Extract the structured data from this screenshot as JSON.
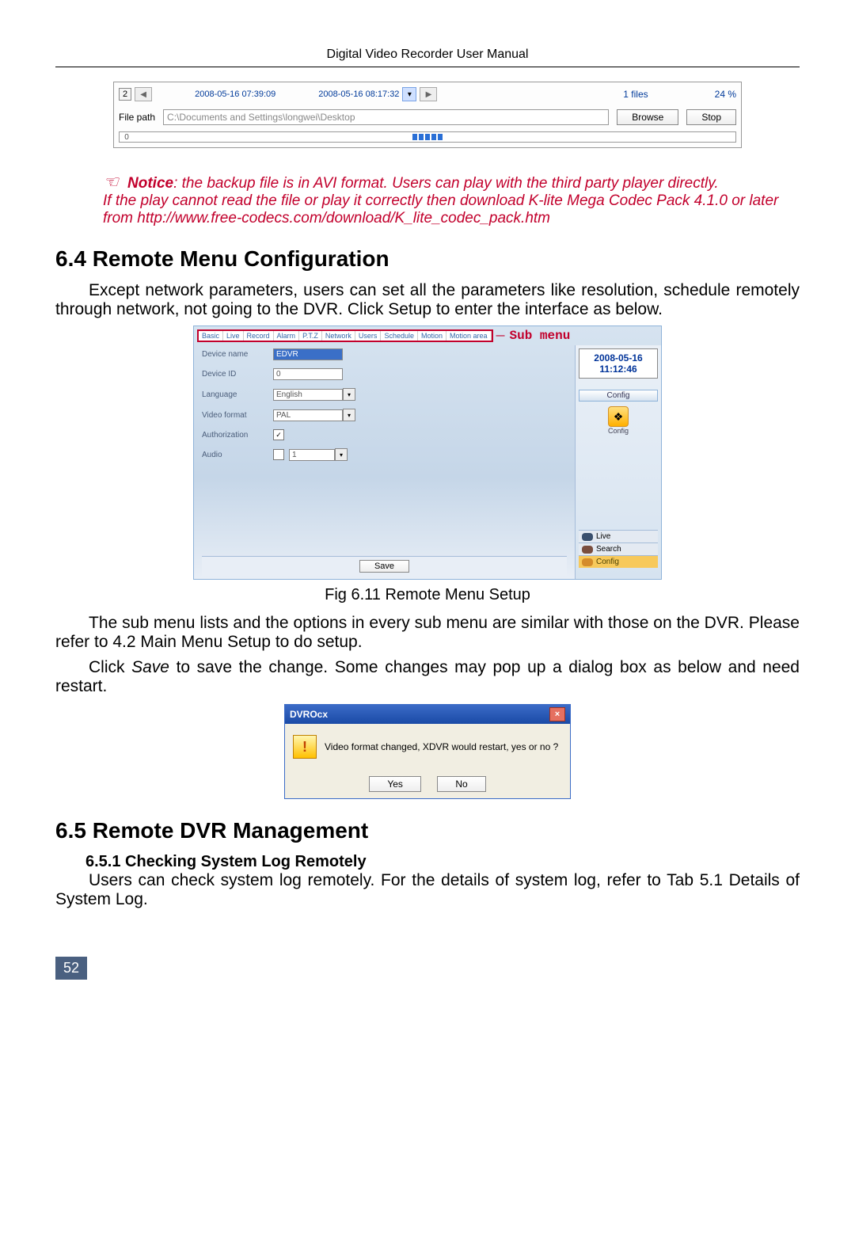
{
  "header": "Digital Video Recorder User Manual",
  "backup": {
    "num": "2",
    "time1": "2008-05-16 07:39:09",
    "time2": "2008-05-16 08:17:32",
    "files": "1 files",
    "pct": "24 %",
    "file_path_label": "File path",
    "file_path_value": "C:\\Documents and Settings\\longwei\\Desktop",
    "browse": "Browse",
    "stop": "Stop",
    "zero": "0"
  },
  "notice": {
    "label": "Notice",
    "line1": ": the backup file is in AVI format. Users can play with the third party player directly.",
    "line2": "If the play cannot read the file or play it correctly then download K-lite Mega Codec Pack 4.1.0 or later from http://www.free-codecs.com/download/K_lite_codec_pack.htm"
  },
  "s64": {
    "title": "6.4  Remote Menu Configuration",
    "para": "Except network parameters, users can set all the parameters like resolution, schedule remotely through network, not going to the DVR. Click Setup to enter the interface as below."
  },
  "remote": {
    "tabs": [
      "Basic",
      "Live",
      "Record",
      "Alarm",
      "P.T.Z",
      "Network",
      "Users",
      "Schedule",
      "Motion",
      "Motion area"
    ],
    "sub_menu": "Sub menu",
    "rows": {
      "device_name_label": "Device name",
      "device_name_value": "EDVR",
      "device_id_label": "Device ID",
      "device_id_value": "0",
      "language_label": "Language",
      "language_value": "English",
      "video_format_label": "Video format",
      "video_format_value": "PAL",
      "authorization_label": "Authorization",
      "audio_label": "Audio",
      "audio_value": "1"
    },
    "date": "2008-05-16",
    "time": "11:12:46",
    "config_btn": "Config",
    "config_caption": "Config",
    "nav_live": "Live",
    "nav_search": "Search",
    "nav_config": "Config",
    "save": "Save"
  },
  "fig611": "Fig 6.11 Remote Menu Setup",
  "para_after_fig": "The sub menu lists and the options in every sub menu are similar with those on the DVR. Please refer to 4.2 Main Menu Setup to do setup.",
  "para_save": "Click Save to save the change. Some changes may pop up a dialog box as below and need restart.",
  "save_word": "Save",
  "dialog": {
    "title": "DVROcx",
    "msg": "Video format changed, XDVR would restart, yes or no ?",
    "yes": "Yes",
    "no": "No"
  },
  "s65": {
    "title": "6.5  Remote DVR Management",
    "h3": "6.5.1  Checking System Log Remotely",
    "para": "Users can check system log remotely. For the details of system log, refer to Tab 5.1 Details of System Log."
  },
  "page_num": "52"
}
